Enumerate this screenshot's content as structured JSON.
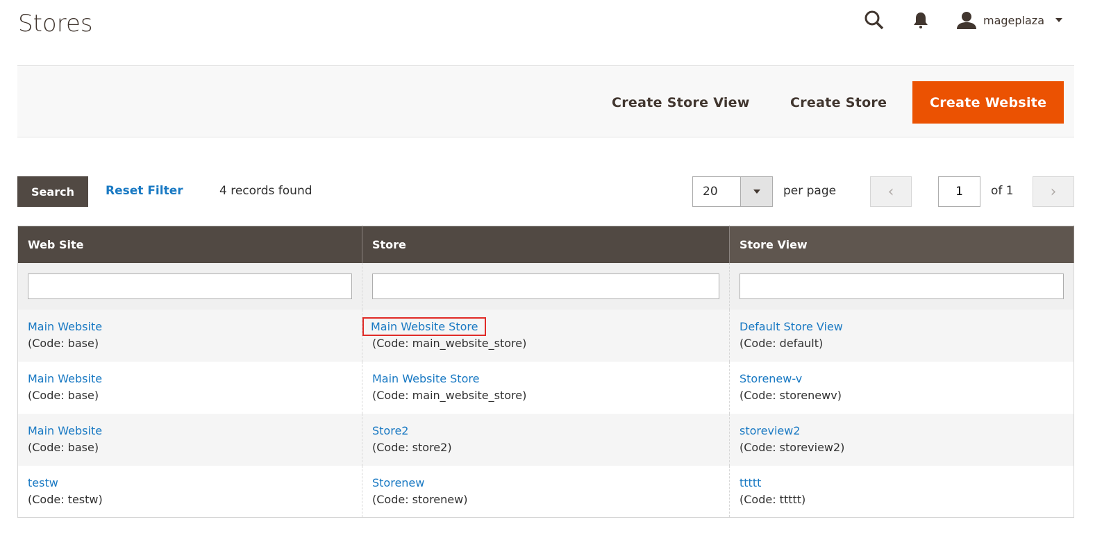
{
  "page_title": "Stores",
  "header": {
    "username": "mageplaza"
  },
  "actions": {
    "create_store_view": "Create Store View",
    "create_store": "Create Store",
    "create_website": "Create Website"
  },
  "grid": {
    "search": "Search",
    "reset_filter": "Reset Filter",
    "records_found": "4 records found",
    "per_page_value": "20",
    "per_page_label": "per page",
    "page": "1",
    "of_pages": "of 1"
  },
  "columns": [
    "Web Site",
    "Store",
    "Store View"
  ],
  "rows": [
    {
      "website": "Main Website",
      "website_code": "(Code: base)",
      "store": "Main Website Store",
      "store_code": "(Code: main_website_store)",
      "view": "Default Store View",
      "view_code": "(Code: default)"
    },
    {
      "website": "Main Website",
      "website_code": "(Code: base)",
      "store": "Main Website Store",
      "store_code": "(Code: main_website_store)",
      "view": "Storenew-v",
      "view_code": "(Code: storenewv)"
    },
    {
      "website": "Main Website",
      "website_code": "(Code: base)",
      "store": "Store2",
      "store_code": "(Code: store2)",
      "view": "storeview2",
      "view_code": "(Code: storeview2)"
    },
    {
      "website": "testw",
      "website_code": "(Code: testw)",
      "store": "Storenew",
      "store_code": "(Code: storenew)",
      "view": "ttttt",
      "view_code": "(Code: ttttt)"
    }
  ]
}
